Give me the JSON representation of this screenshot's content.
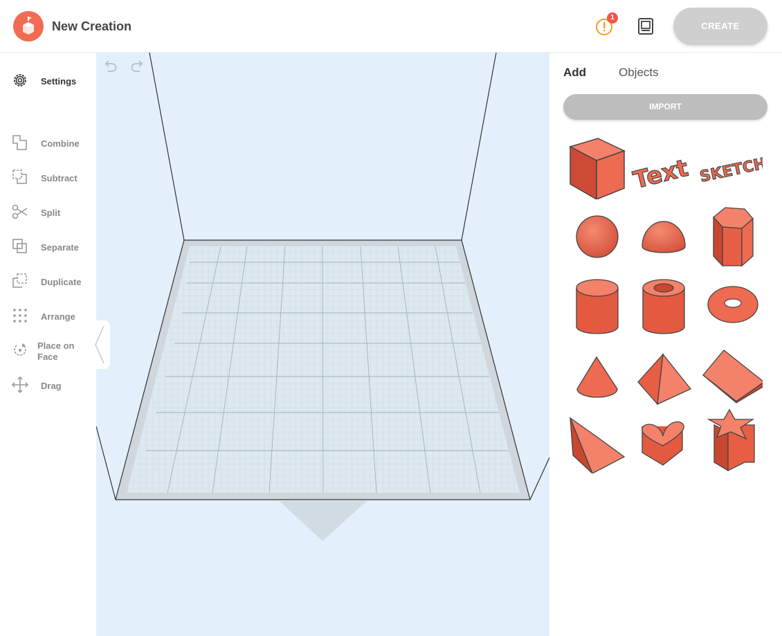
{
  "app": {
    "title": "New Creation"
  },
  "header": {
    "notification_count": "1",
    "create_label": "CREATE"
  },
  "sidebar": {
    "items": [
      {
        "label": "Settings",
        "icon": "gear-icon",
        "active": true
      },
      {
        "label": "Combine",
        "icon": "combine-icon"
      },
      {
        "label": "Subtract",
        "icon": "subtract-icon"
      },
      {
        "label": "Split",
        "icon": "scissors-icon"
      },
      {
        "label": "Separate",
        "icon": "separate-icon"
      },
      {
        "label": "Duplicate",
        "icon": "duplicate-icon"
      },
      {
        "label": "Arrange",
        "icon": "arrange-icon"
      },
      {
        "label_line1": "Place on",
        "label_line2": "Face",
        "icon": "place-on-face-icon"
      },
      {
        "label": "Drag",
        "icon": "drag-icon"
      }
    ]
  },
  "panel": {
    "tabs": [
      {
        "label": "Add"
      },
      {
        "label": "Objects"
      }
    ],
    "import_label": "IMPORT",
    "shapes": [
      "cube",
      "text",
      "sketch",
      "sphere",
      "hemisphere",
      "hexagonal-prism",
      "cylinder",
      "tube",
      "torus",
      "cone",
      "pyramid",
      "wedge",
      "triangular-prism",
      "heart",
      "star"
    ],
    "text_shape_label": "Text",
    "sketch_shape_label": "SKETCH"
  },
  "colors": {
    "brand": "#f26b55",
    "shape_fill": "#ee6a50",
    "canvas_bg": "#e3f0fb",
    "create_button_disabled": "#cfcfcf",
    "badge": "#f0554a"
  }
}
